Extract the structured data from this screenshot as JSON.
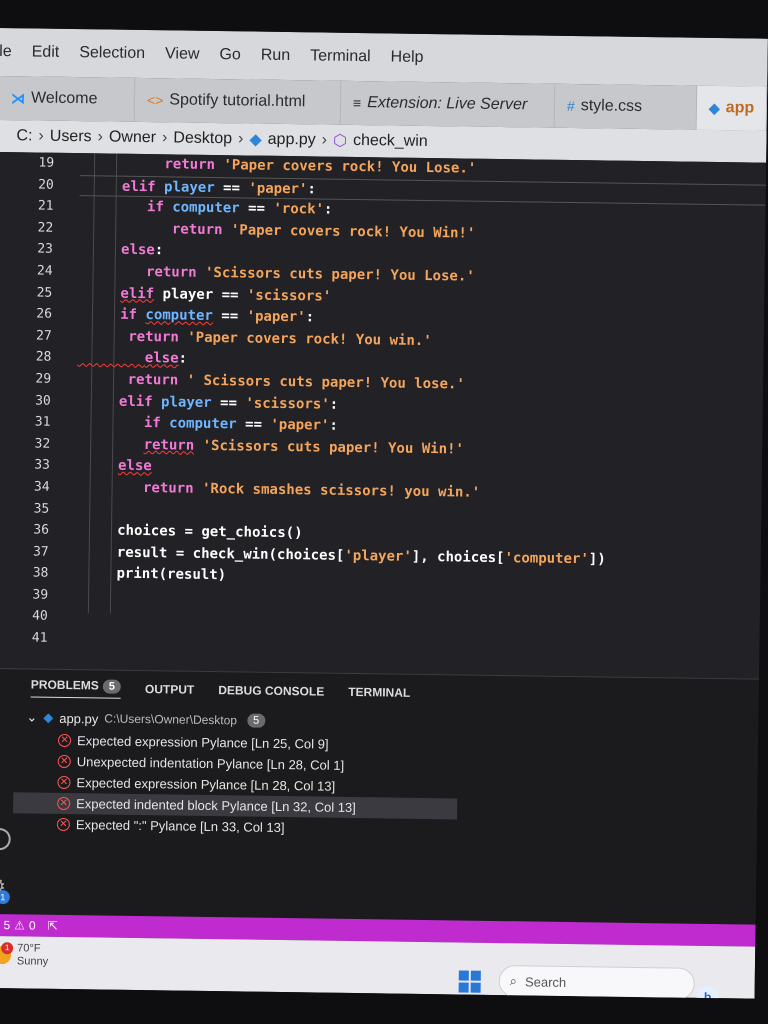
{
  "menu": [
    "ile",
    "Edit",
    "Selection",
    "View",
    "Go",
    "Run",
    "Terminal",
    "Help"
  ],
  "tabs": [
    {
      "label": "Welcome",
      "icon": "vscode-logo-icon"
    },
    {
      "label": "Spotify tutorial.html",
      "icon": "html-icon"
    },
    {
      "label": "Extension: Live Server",
      "icon": "extension-icon"
    },
    {
      "label": "style.css",
      "icon": "css-icon"
    },
    {
      "label": "app",
      "icon": "python-icon"
    }
  ],
  "breadcrumb": [
    "C:",
    "Users",
    "Owner",
    "Desktop",
    "app.py",
    "check_win"
  ],
  "gutter": [
    "19",
    "20",
    "21",
    "22",
    "23",
    "24",
    "25",
    "26",
    "27",
    "28",
    "29",
    "30",
    "31",
    "32",
    "33",
    "34",
    "35",
    "36",
    "37",
    "38",
    "39",
    "40",
    "41"
  ],
  "code": {
    "l19": {
      "kw": "return",
      "str": "'Paper covers rock! You Lose.'"
    },
    "l20": {
      "kw": "elif",
      "var": "player",
      "op": "==",
      "str": "'paper'",
      "end": ":"
    },
    "l21": {
      "kw": "if",
      "var": "computer",
      "op": "==",
      "str": "'rock'",
      "end": ":"
    },
    "l22": {
      "kw": "return",
      "str": "'Paper covers rock! You Win!'"
    },
    "l23": {
      "kw": "else",
      "end": ":"
    },
    "l24": {
      "kw": "return",
      "str": "'Scissors cuts paper! You Lose.'"
    },
    "l25": {
      "kw": "elif",
      "var": "player",
      "op": "==",
      "str": "'scissors'"
    },
    "l26": {
      "kw": "if",
      "var": "computer",
      "op": "==",
      "str": "'paper'",
      "end": ":"
    },
    "l27": {
      "kw": "return",
      "str": "'Paper covers rock! You win.'"
    },
    "l28": {
      "kw": "else",
      "end": ":"
    },
    "l29": {
      "kw": "return",
      "str": "' Scissors cuts paper! You lose.'"
    },
    "l30": {
      "kw": "elif",
      "var": "player",
      "op": "==",
      "str": "'scissors'",
      "end": ":"
    },
    "l31": {
      "kw": "if",
      "var": "computer",
      "op": "==",
      "str": "'paper'",
      "end": ":"
    },
    "l32": {
      "kw": "return",
      "str": "'Scissors cuts paper! You Win!'"
    },
    "l33": {
      "kw": "else"
    },
    "l34": {
      "kw": "return",
      "str": "'Rock smashes scissors! you win.'"
    },
    "l36": {
      "text": "choices = get_choics()"
    },
    "l37": {
      "a": "result = check_win(choices[",
      "s1": "'player'",
      "b": "], choices[",
      "s2": "'computer'",
      "c": "])"
    },
    "l38": {
      "text": "print(result)"
    }
  },
  "panel": {
    "tabs": [
      "PROBLEMS",
      "OUTPUT",
      "DEBUG CONSOLE",
      "TERMINAL"
    ],
    "problems_count": "5",
    "file": "app.py",
    "path": "C:\\Users\\Owner\\Desktop",
    "file_count": "5",
    "problems": [
      "Expected expression Pylance [Ln 25, Col 9]",
      "Unexpected indentation Pylance [Ln 28, Col 1]",
      "Expected expression Pylance [Ln 28, Col 13]",
      "Expected indented block Pylance [Ln 32, Col 13]",
      "Expected \":\" Pylance [Ln 33, Col 13]"
    ]
  },
  "status": {
    "errors": "5",
    "warnings": "0"
  },
  "taskbar": {
    "temp": "70°F",
    "weather": "Sunny",
    "weather_badge": "1",
    "search_placeholder": "Search",
    "activity_badge": "1"
  }
}
